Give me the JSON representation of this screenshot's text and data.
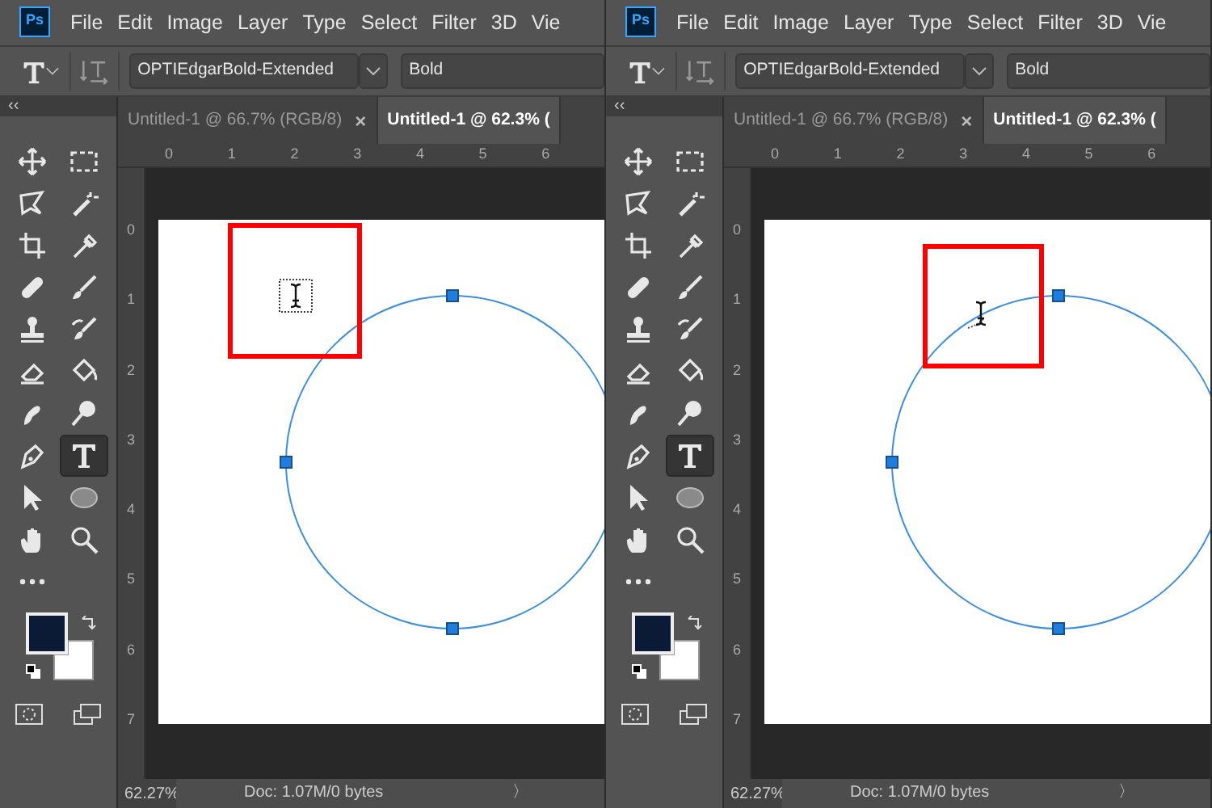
{
  "panels": [
    {
      "logo": "Ps",
      "menu": [
        "File",
        "Edit",
        "Image",
        "Layer",
        "Type",
        "Select",
        "Filter",
        "3D",
        "Vie"
      ],
      "options": {
        "font": "OPTIEdgarBold-Extended",
        "style": "Bold"
      },
      "tools": [
        {
          "kind": "move",
          "selected": false
        },
        {
          "kind": "marquee",
          "selected": false
        },
        {
          "kind": "lasso",
          "selected": false
        },
        {
          "kind": "wand",
          "selected": false
        },
        {
          "kind": "crop",
          "selected": false
        },
        {
          "kind": "eyedropper",
          "selected": false
        },
        {
          "kind": "bandage",
          "selected": false
        },
        {
          "kind": "brush",
          "selected": false
        },
        {
          "kind": "stamp",
          "selected": false
        },
        {
          "kind": "history",
          "selected": false
        },
        {
          "kind": "eraser",
          "selected": false
        },
        {
          "kind": "bucket",
          "selected": false
        },
        {
          "kind": "smudge",
          "selected": false
        },
        {
          "kind": "dodge",
          "selected": false
        },
        {
          "kind": "pen",
          "selected": false
        },
        {
          "kind": "type",
          "selected": true
        },
        {
          "kind": "arrow",
          "selected": false
        },
        {
          "kind": "ellipse",
          "selected": false
        },
        {
          "kind": "hand",
          "selected": false
        },
        {
          "kind": "zoom",
          "selected": false
        },
        {
          "kind": "more",
          "selected": false
        }
      ],
      "collapse": "‹‹",
      "tabs": [
        {
          "label": "Untitled-1 @ 66.7% (RGB/8)",
          "close": "×",
          "selected": false
        },
        {
          "label": "Untitled-1 @ 62.3% (",
          "selected": true
        }
      ],
      "ruler_h": [
        "0",
        "1",
        "2",
        "3",
        "4",
        "5",
        "6"
      ],
      "ruler_v": [
        "0",
        "1",
        "2",
        "3",
        "4",
        "5",
        "6",
        "7"
      ],
      "canvas": {
        "kind": "point"
      },
      "status": {
        "zoom": "62.27%",
        "doc": "Doc: 1.07M/0 bytes",
        "arrow": "〉"
      }
    },
    {
      "logo": "Ps",
      "menu": [
        "File",
        "Edit",
        "Image",
        "Layer",
        "Type",
        "Select",
        "Filter",
        "3D",
        "Vie"
      ],
      "options": {
        "font": "OPTIEdgarBold-Extended",
        "style": "Bold"
      },
      "tools": [
        {
          "kind": "move",
          "selected": false
        },
        {
          "kind": "marquee",
          "selected": false
        },
        {
          "kind": "lasso",
          "selected": false
        },
        {
          "kind": "wand",
          "selected": false
        },
        {
          "kind": "crop",
          "selected": false
        },
        {
          "kind": "eyedropper",
          "selected": false
        },
        {
          "kind": "bandage",
          "selected": false
        },
        {
          "kind": "brush",
          "selected": false
        },
        {
          "kind": "stamp",
          "selected": false
        },
        {
          "kind": "history",
          "selected": false
        },
        {
          "kind": "eraser",
          "selected": false
        },
        {
          "kind": "bucket",
          "selected": false
        },
        {
          "kind": "smudge",
          "selected": false
        },
        {
          "kind": "dodge",
          "selected": false
        },
        {
          "kind": "pen",
          "selected": false
        },
        {
          "kind": "type",
          "selected": true
        },
        {
          "kind": "arrow",
          "selected": false
        },
        {
          "kind": "ellipse",
          "selected": false
        },
        {
          "kind": "hand",
          "selected": false
        },
        {
          "kind": "zoom",
          "selected": false
        },
        {
          "kind": "more",
          "selected": false
        }
      ],
      "collapse": "‹‹",
      "tabs": [
        {
          "label": "Untitled-1 @ 66.7% (RGB/8)",
          "close": "×",
          "selected": false
        },
        {
          "label": "Untitled-1 @ 62.3% (",
          "selected": true
        }
      ],
      "ruler_h": [
        "0",
        "1",
        "2",
        "3",
        "4",
        "5",
        "6"
      ],
      "ruler_v": [
        "0",
        "1",
        "2",
        "3",
        "4",
        "5",
        "6",
        "7"
      ],
      "canvas": {
        "kind": "path"
      },
      "status": {
        "zoom": "62.27%",
        "doc": "Doc: 1.07M/0 bytes",
        "arrow": "〉"
      }
    }
  ]
}
